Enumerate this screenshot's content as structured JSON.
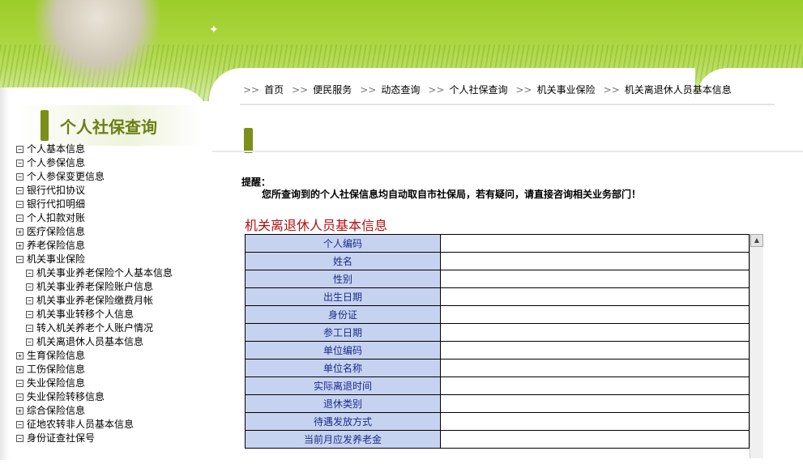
{
  "breadcrumb": {
    "separator": ">>",
    "items": [
      "首页",
      "便民服务",
      "动态查询",
      "个人社保查询",
      "机关事业保险",
      "机关离退休人员基本信息"
    ]
  },
  "sidebar": {
    "title": "个人社保查询",
    "items": [
      {
        "toggle": "⊟",
        "label": "个人基本信息",
        "sub": false
      },
      {
        "toggle": "⊟",
        "label": "个人参保信息",
        "sub": false
      },
      {
        "toggle": "⊟",
        "label": "个人参保变更信息",
        "sub": false
      },
      {
        "toggle": "⊟",
        "label": "银行代扣协议",
        "sub": false
      },
      {
        "toggle": "⊟",
        "label": "银行代扣明细",
        "sub": false
      },
      {
        "toggle": "⊟",
        "label": "个人扣款对账",
        "sub": false
      },
      {
        "toggle": "⊞",
        "label": "医疗保险信息",
        "sub": false
      },
      {
        "toggle": "⊞",
        "label": "养老保险信息",
        "sub": false
      },
      {
        "toggle": "⊟",
        "label": "机关事业保险",
        "sub": false
      },
      {
        "toggle": "⊟",
        "label": "机关事业养老保险个人基本信息",
        "sub": true
      },
      {
        "toggle": "⊟",
        "label": "机关事业养老保险账户信息",
        "sub": true
      },
      {
        "toggle": "⊟",
        "label": "机关事业养老保险缴费月帐",
        "sub": true
      },
      {
        "toggle": "⊟",
        "label": "机关事业转移个人信息",
        "sub": true
      },
      {
        "toggle": "⊟",
        "label": "转入机关养老个人账户情况",
        "sub": true
      },
      {
        "toggle": "⊟",
        "label": "机关离退休人员基本信息",
        "sub": true
      },
      {
        "toggle": "⊞",
        "label": "生育保险信息",
        "sub": false
      },
      {
        "toggle": "⊞",
        "label": "工伤保险信息",
        "sub": false
      },
      {
        "toggle": "⊟",
        "label": "失业保险信息",
        "sub": false
      },
      {
        "toggle": "⊟",
        "label": "失业保险转移信息",
        "sub": false
      },
      {
        "toggle": "⊞",
        "label": "综合保险信息",
        "sub": false
      },
      {
        "toggle": "⊟",
        "label": "征地农转非人员基本信息",
        "sub": false
      },
      {
        "toggle": "⊟",
        "label": "身份证查社保号",
        "sub": false
      }
    ]
  },
  "reminder": {
    "label": "提醒：",
    "text": "您所查询到的个人社保信息均自动取自市社保局，若有疑问，请直接咨询相关业务部门！"
  },
  "table": {
    "title": "机关离退休人员基本信息",
    "rows": [
      {
        "key": "个人编码",
        "value": ""
      },
      {
        "key": "姓名",
        "value": ""
      },
      {
        "key": "性别",
        "value": ""
      },
      {
        "key": "出生日期",
        "value": ""
      },
      {
        "key": "身份证",
        "value": ""
      },
      {
        "key": "参工日期",
        "value": ""
      },
      {
        "key": "单位编码",
        "value": ""
      },
      {
        "key": "单位名称",
        "value": ""
      },
      {
        "key": "实际离退时间",
        "value": ""
      },
      {
        "key": "退休类别",
        "value": ""
      },
      {
        "key": "待遇发放方式",
        "value": ""
      },
      {
        "key": "当前月应发养老金",
        "value": ""
      }
    ]
  },
  "scrollbar": {
    "up_arrow": "▲"
  },
  "colors": {
    "accent_green": "#7c8f1a",
    "title_red": "#b01010",
    "key_cell_bg": "#c6d3f0"
  }
}
